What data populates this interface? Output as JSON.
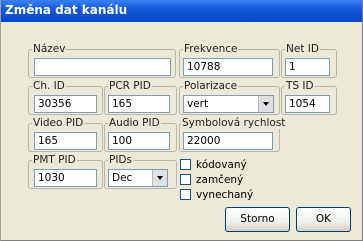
{
  "window": {
    "title": "Změna dat kanálu"
  },
  "fields": {
    "nazev": {
      "label": "Název",
      "value": ""
    },
    "frekvence": {
      "label": "Frekvence",
      "value": "10788"
    },
    "net_id": {
      "label": "Net ID",
      "value": "1"
    },
    "ch_id": {
      "label": "Ch. ID",
      "value": "30356"
    },
    "pcr_pid": {
      "label": "PCR PID",
      "value": "165"
    },
    "polarizace": {
      "label": "Polarizace",
      "value": "vert"
    },
    "ts_id": {
      "label": "TS ID",
      "value": "1054"
    },
    "video_pid": {
      "label": "Video PID",
      "value": "165"
    },
    "audio_pid": {
      "label": "Audio PID",
      "value": "100"
    },
    "symbolova_rychlost": {
      "label": "Symbolová rychlost",
      "value": "22000"
    },
    "pmt_pid": {
      "label": "PMT PID",
      "value": "1030"
    },
    "pids": {
      "label": "PIDs",
      "value": "Dec"
    }
  },
  "checkboxes": {
    "kodovany": {
      "label": "kódovaný",
      "checked": false
    },
    "zamceny": {
      "label": "zamčený",
      "checked": false
    },
    "vynechany": {
      "label": "vynechaný",
      "checked": false
    }
  },
  "buttons": {
    "storno": "Storno",
    "ok": "OK"
  }
}
